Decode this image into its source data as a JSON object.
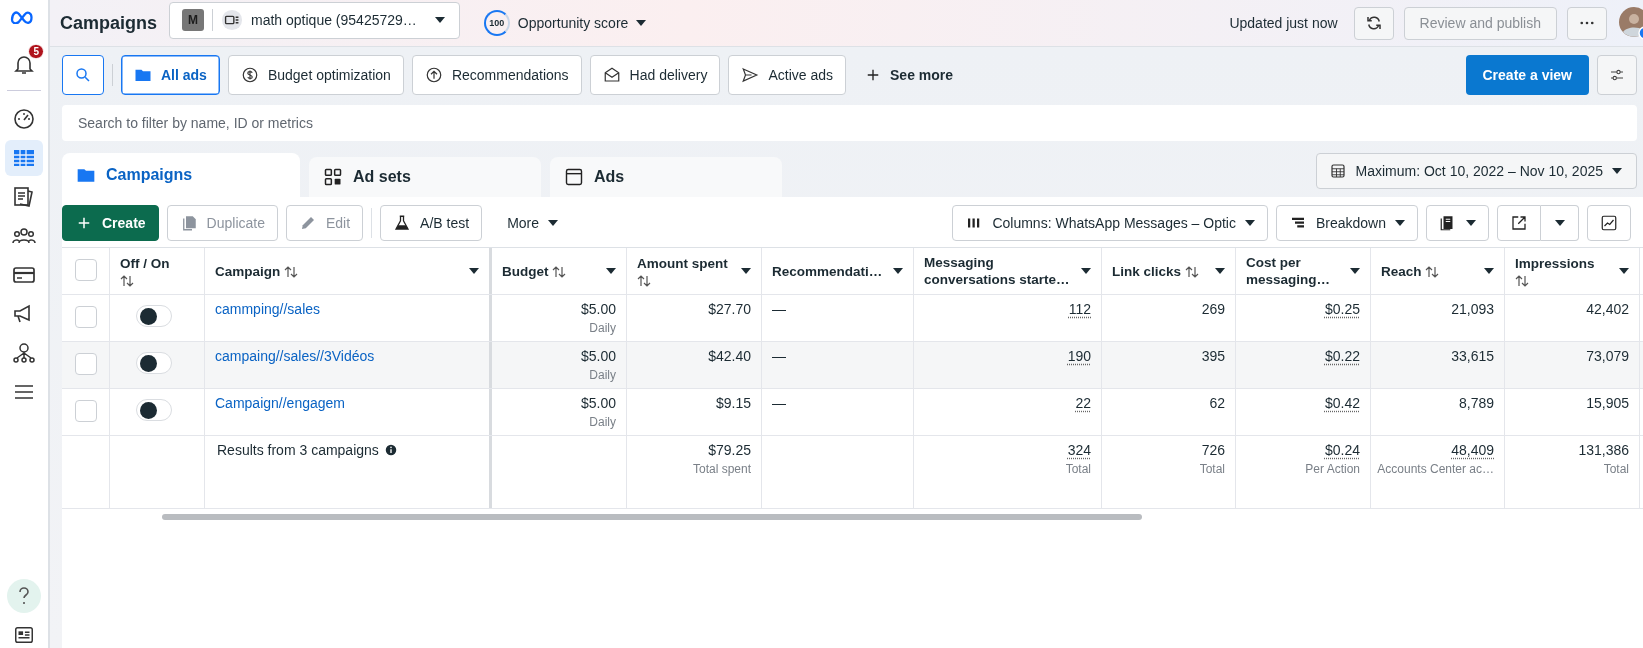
{
  "sidebar": {
    "notification_count": "5",
    "items": [
      {
        "kind": "gauge",
        "selected": false
      },
      {
        "kind": "table",
        "selected": true
      },
      {
        "kind": "pages",
        "selected": false
      },
      {
        "kind": "people",
        "selected": false
      },
      {
        "kind": "card",
        "selected": false
      },
      {
        "kind": "megaphone",
        "selected": false
      },
      {
        "kind": "network",
        "selected": false
      },
      {
        "kind": "menu",
        "selected": false
      }
    ]
  },
  "header": {
    "title": "Campaigns",
    "account_badge": "M",
    "account_name": "math optique (95425729…",
    "opportunity_score": "100",
    "opportunity_label": "Opportunity score",
    "updated": "Updated just now",
    "review_button": {
      "label": "Review and publish",
      "disabled": true
    }
  },
  "filters": [
    {
      "kind": "folder",
      "label": "All ads",
      "selected": true
    },
    {
      "kind": "dollar",
      "label": "Budget optimization",
      "selected": false
    },
    {
      "kind": "up",
      "label": "Recommendations",
      "selected": false
    },
    {
      "kind": "mail",
      "label": "Had delivery",
      "selected": false
    },
    {
      "kind": "send",
      "label": "Active ads",
      "selected": false
    }
  ],
  "see_more": "See more",
  "create_view": "Create a view",
  "search": {
    "placeholder": "Search to filter by name, ID or metrics"
  },
  "level_tabs": [
    {
      "kind": "folder",
      "label": "Campaigns",
      "selected": true
    },
    {
      "kind": "grid",
      "label": "Ad sets",
      "selected": false
    },
    {
      "kind": "window",
      "label": "Ads",
      "selected": false
    }
  ],
  "date_range": "Maximum: Oct 10, 2022 – Nov 10, 2025",
  "toolbar": [
    {
      "kind": "plus",
      "label": "Create",
      "primary": true,
      "disabled": false
    },
    {
      "kind": "copy",
      "label": "Duplicate",
      "primary": false,
      "disabled": true
    },
    {
      "kind": "pencil",
      "label": "Edit",
      "primary": false,
      "disabled": true
    },
    {
      "kind": "flask",
      "label": "A/B test",
      "primary": false,
      "disabled": false
    },
    {
      "kind": "more",
      "label": "More",
      "primary": false,
      "disabled": false
    }
  ],
  "columns_button": "Columns: WhatsApp Messages – Optic",
  "breakdown_button": "Breakdown",
  "table": {
    "select_all_checked": false,
    "columns": [
      {
        "label": "Off / On",
        "sortable": true,
        "menu": false
      },
      {
        "label": "Campaign",
        "sortable": true,
        "menu": true
      },
      {
        "label": "Budget",
        "sortable": true,
        "menu": true
      },
      {
        "label": "Amount spent",
        "sortable": true,
        "menu": true
      },
      {
        "label": "Recommendati…",
        "sortable": false,
        "menu": true
      },
      {
        "label": "Messaging conversations starte…",
        "sortable": false,
        "menu": true
      },
      {
        "label": "Link clicks",
        "sortable": true,
        "menu": true
      },
      {
        "label": "Cost per messaging…",
        "sortable": false,
        "menu": true
      },
      {
        "label": "Reach",
        "sortable": true,
        "menu": true
      },
      {
        "label": "Impressions",
        "sortable": true,
        "menu": true
      }
    ],
    "rows": [
      {
        "checked": false,
        "cells": [
          {
            "kind": "toggle",
            "on": false
          },
          {
            "kind": "link",
            "value": "cammping//sales"
          },
          {
            "value": "$5.00",
            "note": "Daily"
          },
          {
            "value": "$27.70"
          },
          {
            "value": "—"
          },
          {
            "value": "112",
            "dotted": true
          },
          {
            "value": "269"
          },
          {
            "value": "$0.25",
            "dotted": true
          },
          {
            "value": "21,093"
          },
          {
            "value": "42,402"
          }
        ]
      },
      {
        "checked": false,
        "cells": [
          {
            "kind": "toggle",
            "on": false
          },
          {
            "kind": "link",
            "value": "campaing//sales//3Vidéos"
          },
          {
            "value": "$5.00",
            "note": "Daily"
          },
          {
            "value": "$42.40"
          },
          {
            "value": "—"
          },
          {
            "value": "190",
            "dotted": true
          },
          {
            "value": "395"
          },
          {
            "value": "$0.22",
            "dotted": true
          },
          {
            "value": "33,615"
          },
          {
            "value": "73,079"
          }
        ]
      },
      {
        "checked": false,
        "cells": [
          {
            "kind": "toggle",
            "on": false
          },
          {
            "kind": "link",
            "value": "Campaign//engagem"
          },
          {
            "value": "$5.00",
            "note": "Daily"
          },
          {
            "value": "$9.15"
          },
          {
            "value": "—"
          },
          {
            "value": "22",
            "dotted": true
          },
          {
            "value": "62"
          },
          {
            "value": "$0.42",
            "dotted": true
          },
          {
            "value": "8,789"
          },
          {
            "value": "15,905"
          }
        ]
      }
    ],
    "totals": {
      "cells": [
        null,
        {
          "kind": "summary",
          "value": "Results from 3 campaigns"
        },
        null,
        {
          "value": "$79.25",
          "note": "Total spent"
        },
        null,
        {
          "value": "324",
          "note": "Total",
          "dotted": true
        },
        {
          "value": "726",
          "note": "Total"
        },
        {
          "value": "$0.24",
          "note": "Per Action",
          "dotted": true
        },
        {
          "value": "48,409",
          "note": "Accounts Center ac…",
          "dotted": true
        },
        {
          "value": "131,386",
          "note": "Total"
        }
      ]
    }
  }
}
